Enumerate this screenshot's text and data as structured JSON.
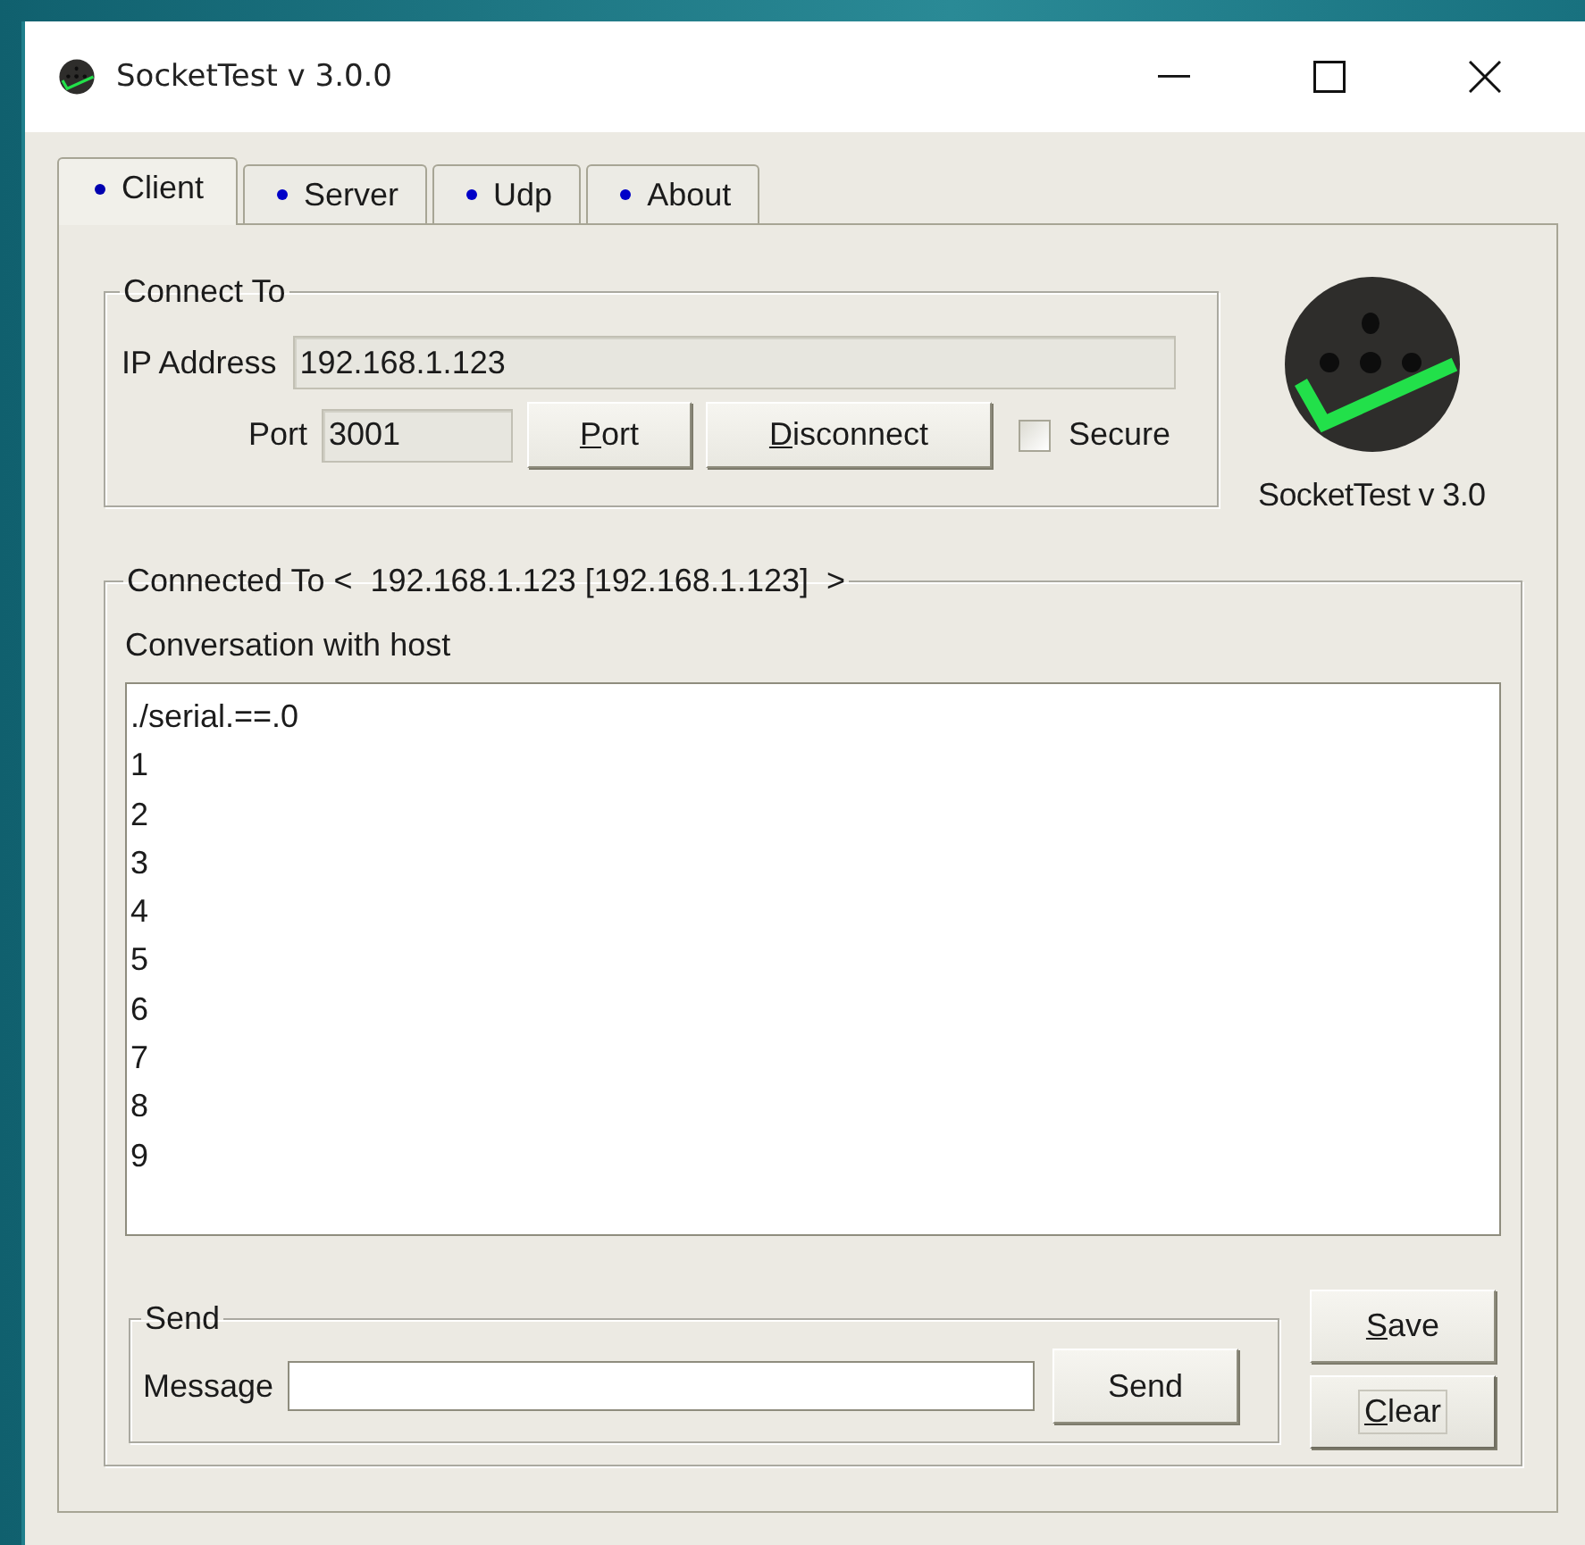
{
  "window": {
    "title": "SocketTest v 3.0.0"
  },
  "tabs": [
    {
      "label": "Client",
      "selected": true
    },
    {
      "label": "Server",
      "selected": false
    },
    {
      "label": "Udp",
      "selected": false
    },
    {
      "label": "About",
      "selected": false
    }
  ],
  "connect_to": {
    "legend": "Connect To",
    "ip_label": "IP Address",
    "ip_value": "192.168.1.123",
    "port_label": "Port",
    "port_value": "3001",
    "buttons": [
      {
        "label": "Port",
        "mnemonic": true,
        "focused": false
      },
      {
        "label": "Disconnect",
        "mnemonic": true,
        "focused": false
      }
    ],
    "secure": {
      "label": "Secure",
      "checked": false
    }
  },
  "logo_caption": "SocketTest v 3.0",
  "connection": {
    "legend": "Connected To <  192.168.1.123 [192.168.1.123]  >",
    "conversation_label": "Conversation with host",
    "lines": [
      "./serial.==.0",
      "1",
      "2",
      "3",
      "4",
      "5",
      "6",
      "7",
      "8",
      "9"
    ]
  },
  "send": {
    "legend": "Send",
    "message_label": "Message",
    "button": "Send"
  },
  "side_buttons": [
    {
      "label": "Save",
      "mnemonic": true,
      "focused": false
    },
    {
      "label": "Clear",
      "mnemonic": true,
      "focused": true
    }
  ]
}
